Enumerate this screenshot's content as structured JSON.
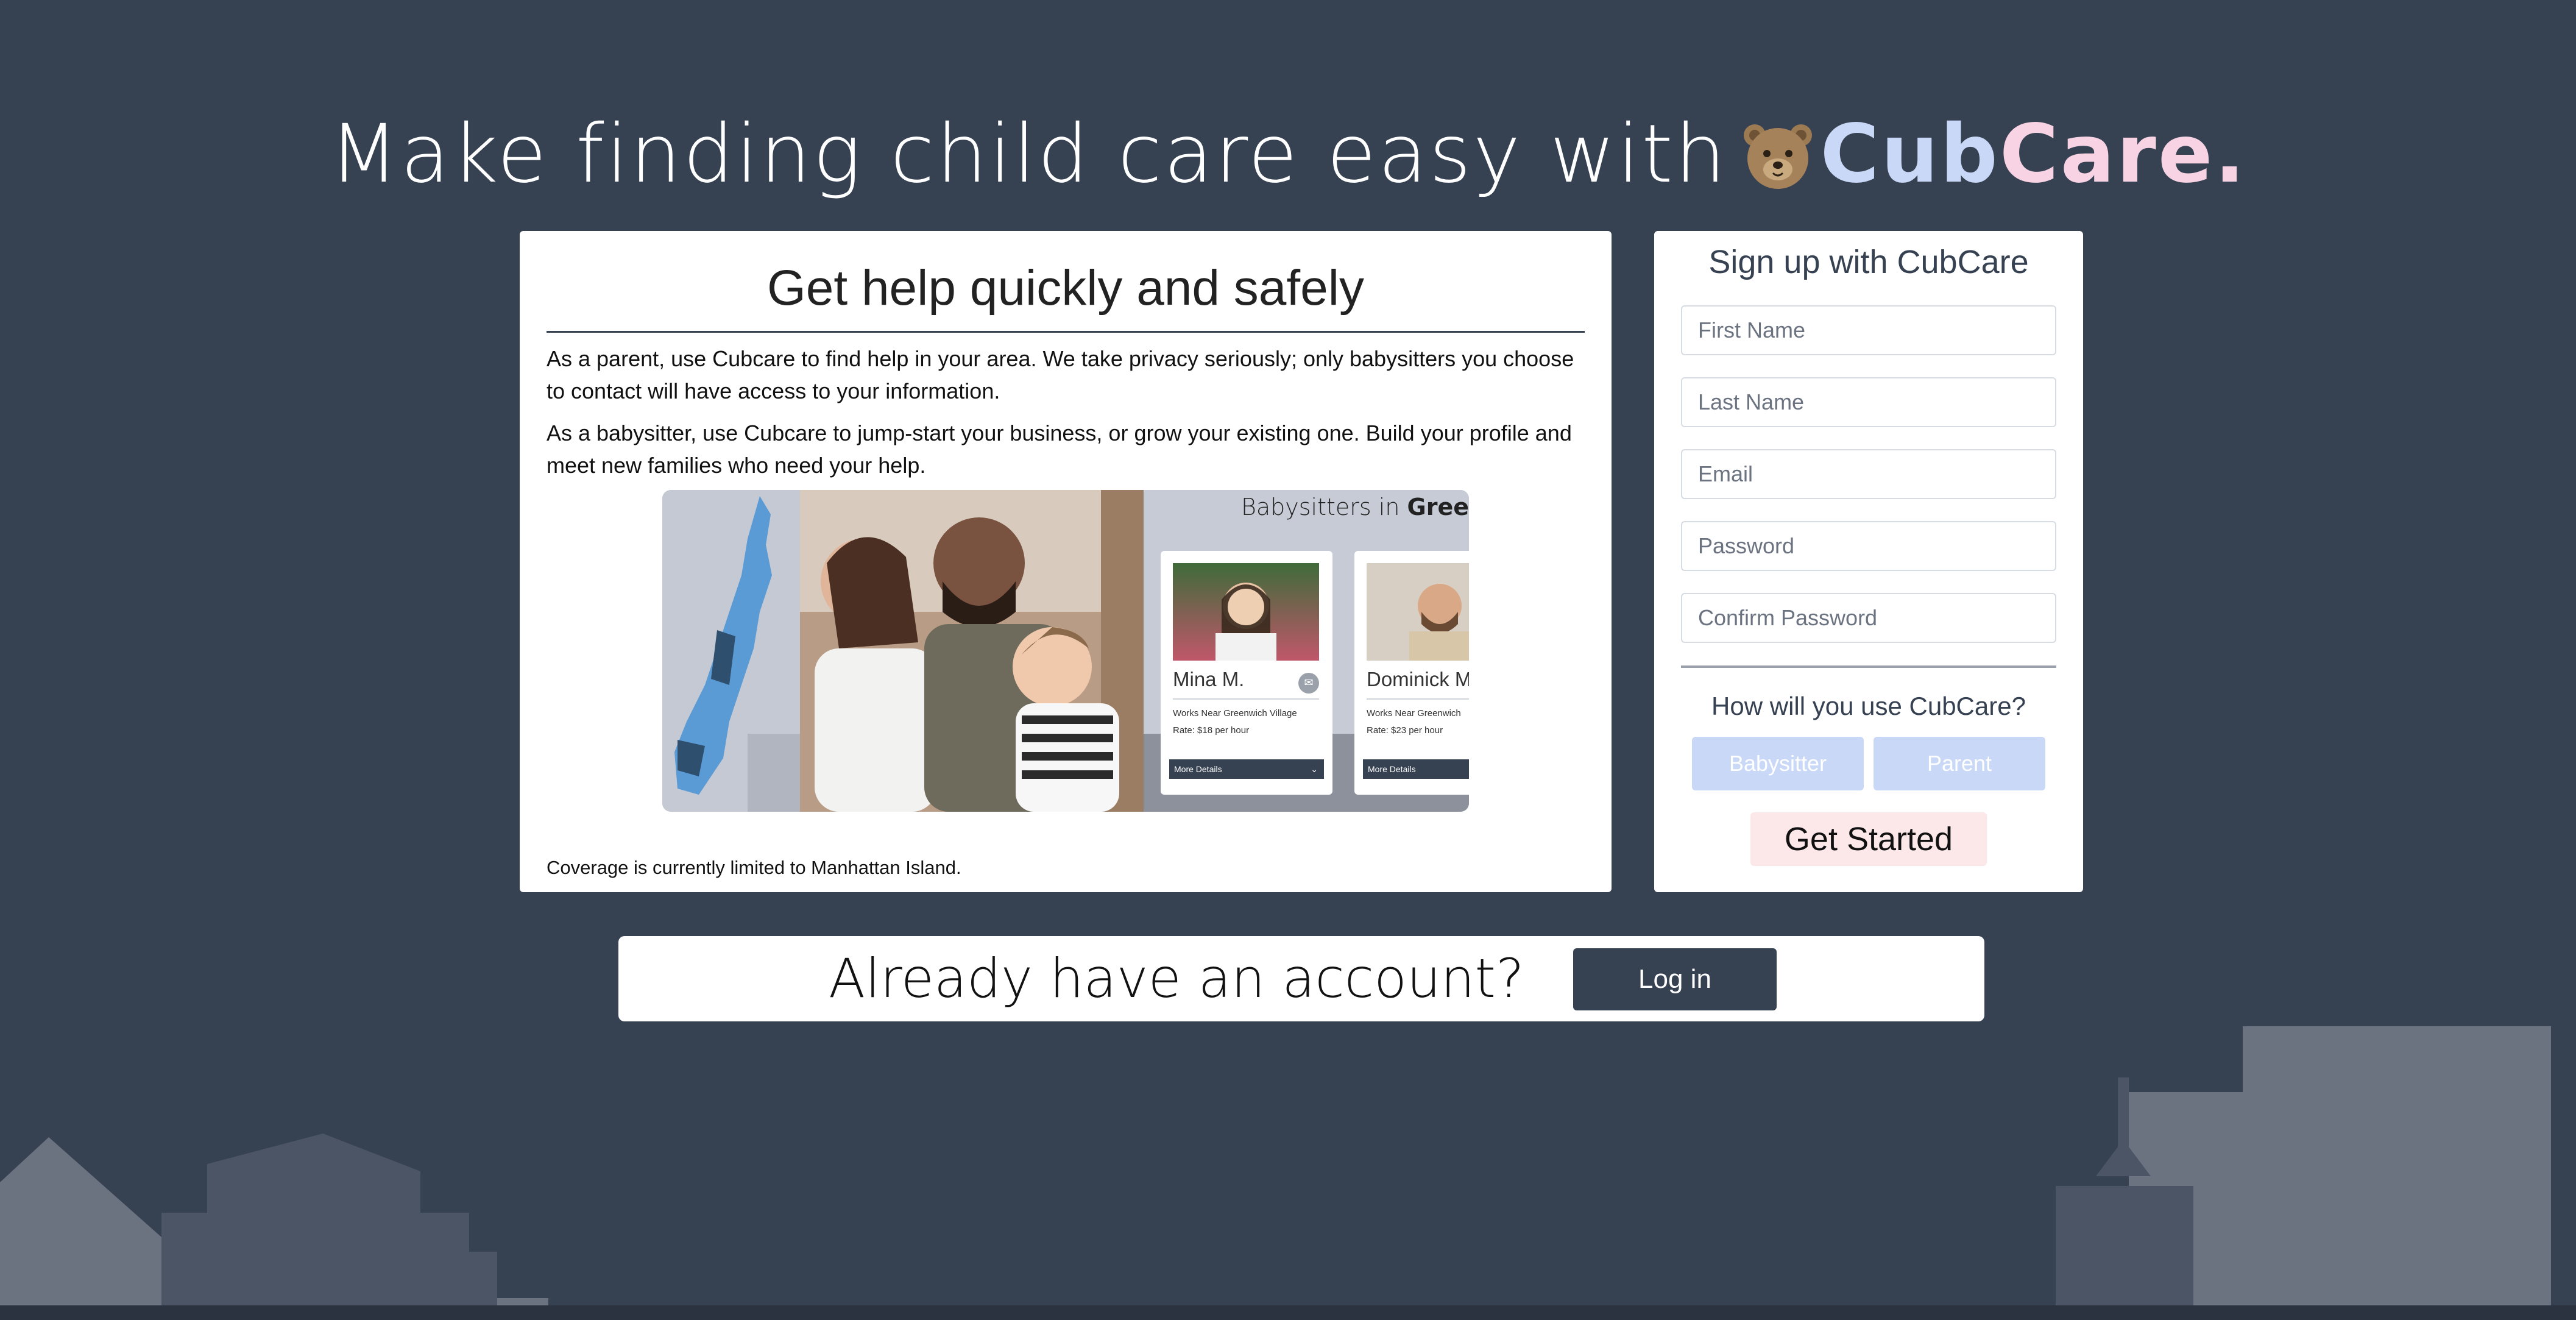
{
  "headline": {
    "prefix": "Make finding child care easy with",
    "brand_cub": "CubCare",
    "brand_dot": "."
  },
  "info": {
    "title": "Get help quickly and safely",
    "para_parent": "As a parent, use Cubcare to find help in your area. We take privacy seriously; only babysitters you choose to contact will have access to your information.",
    "para_babysitter": "As a babysitter, use Cubcare to jump-start your business, or grow your existing one. Build your profile and meet new families who need your help.",
    "coverage": "Coverage is currently limited to Manhattan Island.",
    "preview": {
      "banner_prefix": "Babysitters in",
      "banner_place": "Gree",
      "cards": [
        {
          "name": "Mina M.",
          "works": "Works Near Greenwich Village",
          "rate": "Rate: $18 per hour",
          "more": "More Details"
        },
        {
          "name": "Dominick M",
          "works": "Works Near Greenwich",
          "rate": "Rate: $23 per hour",
          "more": "More Details"
        }
      ]
    }
  },
  "signup": {
    "title": "Sign up with CubCare",
    "first_name_placeholder": "First Name",
    "last_name_placeholder": "Last Name",
    "email_placeholder": "Email",
    "password_placeholder": "Password",
    "confirm_password_placeholder": "Confirm Password",
    "use_question": "How will you use CubCare?",
    "babysitter_label": "Babysitter",
    "parent_label": "Parent",
    "start_label": "Get Started"
  },
  "login": {
    "question": "Already have an account?",
    "button_label": "Log in"
  },
  "colors": {
    "background": "#364152",
    "brand_blue": "#c9d8f7",
    "brand_pink": "#f8d3e3",
    "start_button": "#fce7e9",
    "login_button": "#364152"
  },
  "icons": {
    "logo": "bear-face-icon",
    "message": "envelope-icon",
    "expand": "chevron-down-icon"
  }
}
